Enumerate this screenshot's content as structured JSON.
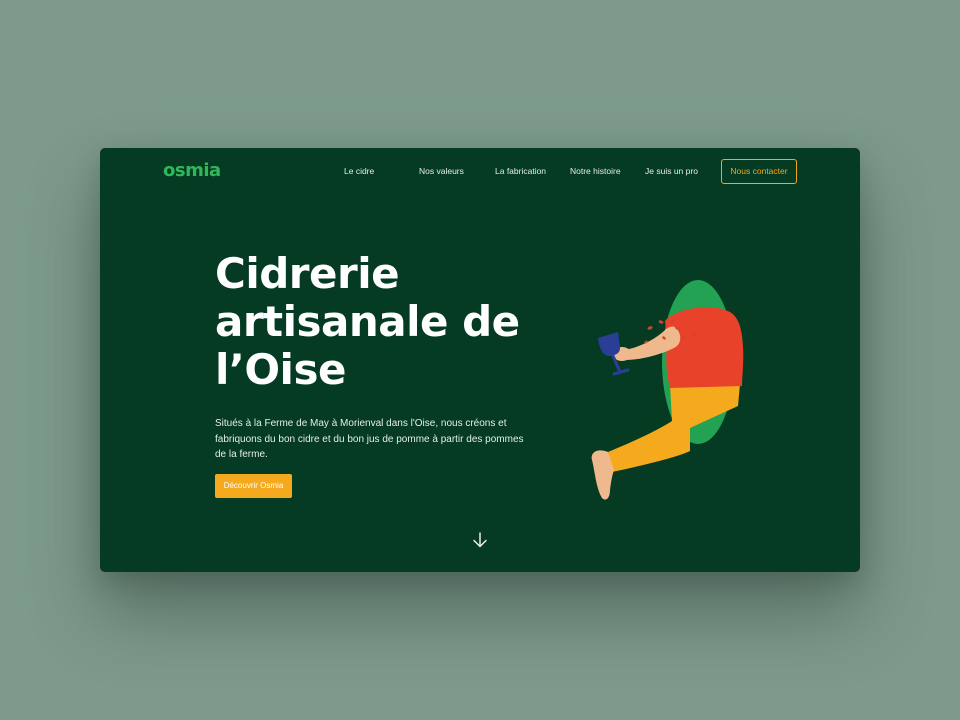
{
  "brand": {
    "logo_text": "osmia"
  },
  "nav": {
    "items": [
      {
        "label": "Le cidre"
      },
      {
        "label": "Nos valeurs"
      },
      {
        "label": "La fabrication"
      },
      {
        "label": "Notre histoire"
      },
      {
        "label": "Je suis un pro"
      }
    ],
    "contact_label": "Nous contacter"
  },
  "hero": {
    "title": "Cidrerie artisanale de l’Oise",
    "description": "Situés à la Ferme de May à Morienval dans l'Oise, nous créons et fabriquons du bon cidre et du bon jus de pomme à partir des pommes de la ferme.",
    "cta_label": "Découvrir Osmia"
  },
  "icons": {
    "scroll": "arrow-down-icon"
  },
  "colors": {
    "background": "#7d9a8b",
    "window": "#053b22",
    "logo": "#2fb85a",
    "accent": "#f5a91c",
    "shirt": "#e8432a",
    "pants": "#f5a91c",
    "hole": "#23a253"
  }
}
